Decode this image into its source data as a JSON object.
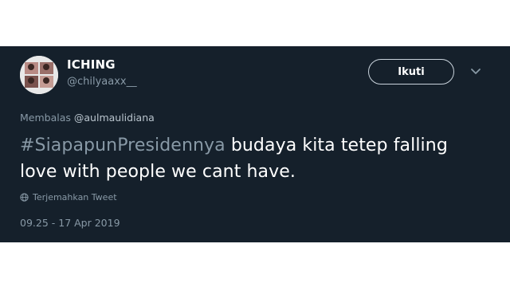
{
  "user": {
    "display_name": "ICHING",
    "handle": "@chilyaaxx__"
  },
  "actions": {
    "follow_label": "Ikuti",
    "more_icon": "chevron-down-icon"
  },
  "reply": {
    "prefix": "Membalas",
    "mention": "@aulmaulidiana"
  },
  "tweet": {
    "hashtag": "#SiapapunPresidennya",
    "text_after_hashtag": " budaya kita tetep falling love with people we cant have."
  },
  "translate": {
    "label": "Terjemahkan Tweet",
    "icon": "globe-icon"
  },
  "timestamp": "09.25 - 17 Apr 2019",
  "colors": {
    "background": "#15202b",
    "primary_text": "#ffffff",
    "secondary_text": "#8899a6"
  }
}
